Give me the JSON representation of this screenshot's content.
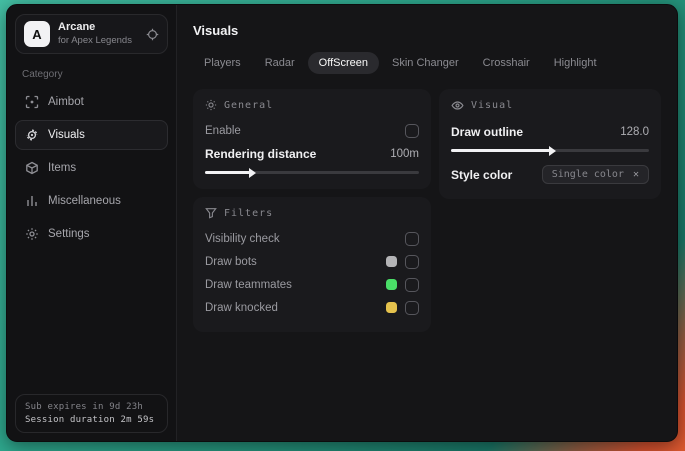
{
  "desktop": {
    "teal": "#2ea78d",
    "orange": "#d4512f"
  },
  "sidebar": {
    "brand": {
      "initial": "A",
      "name": "Arcane",
      "subtitle": "for Apex Legends"
    },
    "category_label": "Category",
    "items": [
      {
        "label": "Aimbot",
        "icon": "crosshair-icon",
        "active": false
      },
      {
        "label": "Visuals",
        "icon": "eye-scan-icon",
        "active": true
      },
      {
        "label": "Items",
        "icon": "box-icon",
        "active": false
      },
      {
        "label": "Miscellaneous",
        "icon": "bars-icon",
        "active": false
      },
      {
        "label": "Settings",
        "icon": "gear-icon",
        "active": false
      }
    ],
    "footer": {
      "sub_expires": "Sub expires in 9d 23h",
      "session_duration": "Session duration 2m 59s"
    }
  },
  "header": {
    "title": "Visuals"
  },
  "tabs": [
    {
      "label": "Players",
      "active": false
    },
    {
      "label": "Radar",
      "active": false
    },
    {
      "label": "OffScreen",
      "active": true
    },
    {
      "label": "Skin Changer",
      "active": false
    },
    {
      "label": "Crosshair",
      "active": false
    },
    {
      "label": "Highlight",
      "active": false
    }
  ],
  "panels": {
    "general": {
      "title": "General",
      "enable": {
        "label": "Enable",
        "checked": false
      },
      "rendering_distance": {
        "label": "Rendering distance",
        "value": "100m",
        "percent": 21
      }
    },
    "visual": {
      "title": "Visual",
      "draw_outline": {
        "label": "Draw outline",
        "value": "128.0",
        "percent": 50
      },
      "style_color": {
        "label": "Style color",
        "selected": "Single color",
        "clear_glyph": "✕"
      }
    },
    "filters": {
      "title": "Filters",
      "rows": [
        {
          "label": "Visibility check",
          "checked": false
        },
        {
          "label": "Draw bots",
          "swatch": "#b4b4b6",
          "checked": false
        },
        {
          "label": "Draw teammates",
          "swatch": "#4ade68",
          "checked": false
        },
        {
          "label": "Draw knocked",
          "swatch": "#e5c24d",
          "checked": false
        }
      ]
    }
  }
}
